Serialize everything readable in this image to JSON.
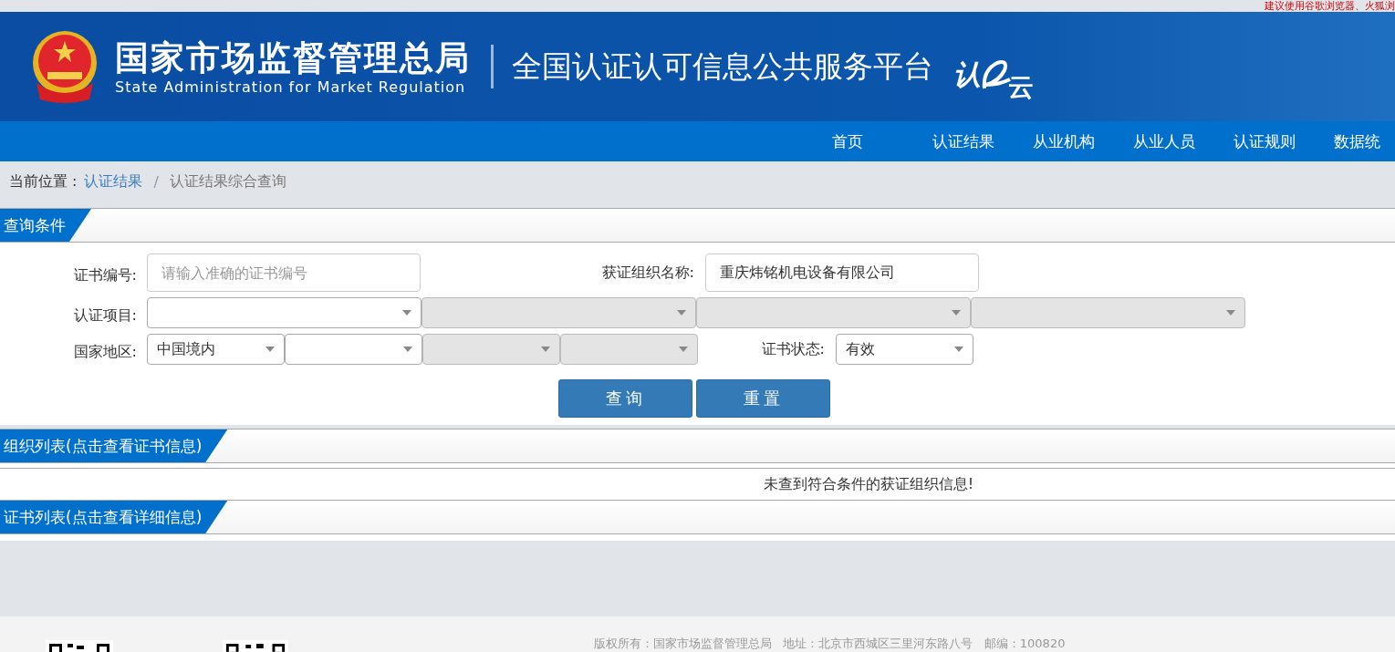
{
  "top_notice": "建议使用谷歌浏览器、火狐浏",
  "header": {
    "agency_name": "国家市场监督管理总局",
    "agency_name_en": "State Administration  for  Market Regulation",
    "platform_title": "全国认证认可信息公共服务平台",
    "logo_text_1": "认",
    "logo_text_2": "云"
  },
  "nav": [
    "首页",
    "认证结果",
    "从业机构",
    "从业人员",
    "认证规则",
    "数据统"
  ],
  "breadcrumb": {
    "label": "当前位置 :",
    "link": "认证结果",
    "separator": "/",
    "current": "认证结果综合查询"
  },
  "query_section": {
    "title": "查询条件",
    "cert_number": {
      "label": "证书编号:",
      "placeholder": "请输入准确的证书编号"
    },
    "org_name": {
      "label": "获证组织名称:",
      "value": "重庆炜铭机电设备有限公司"
    },
    "cert_project": {
      "label": "认证项目:",
      "selects": [
        {
          "disabled": false
        },
        {
          "disabled": true
        },
        {
          "disabled": true
        },
        {
          "disabled": true
        }
      ]
    },
    "region": {
      "label": "国家地区:",
      "selects": [
        {
          "value": "中国境内",
          "disabled": false
        },
        {
          "disabled": false
        },
        {
          "disabled": true
        },
        {
          "disabled": true
        }
      ]
    },
    "cert_status": {
      "label": "证书状态:",
      "value": "有效"
    },
    "buttons": [
      "查询",
      "重置"
    ]
  },
  "org_section": {
    "title": "组织列表(点击查看证书信息)",
    "message": "未查到符合条件的获证组织信息!"
  },
  "cert_section": {
    "title": "证书列表(点击查看详细信息)"
  },
  "footer": {
    "text": "版权所有：国家市场监督管理总局   地址：北京市西城区三里河东路八号   邮编：100820"
  }
}
